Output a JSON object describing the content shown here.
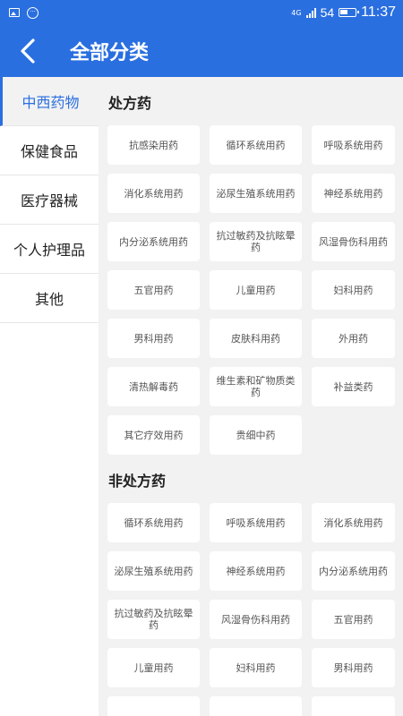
{
  "status_bar": {
    "network": "4G",
    "battery": "54",
    "time": "11:37"
  },
  "header": {
    "title": "全部分类"
  },
  "sidebar": {
    "items": [
      {
        "label": "中西药物",
        "active": true
      },
      {
        "label": "保健食品",
        "active": false
      },
      {
        "label": "医疗器械",
        "active": false
      },
      {
        "label": "个人护理品",
        "active": false
      },
      {
        "label": "其他",
        "active": false
      }
    ]
  },
  "sections": [
    {
      "title": "处方药",
      "items": [
        "抗感染用药",
        "循环系统用药",
        "呼吸系统用药",
        "消化系统用药",
        "泌尿生殖系统用药",
        "神经系统用药",
        "内分泌系统用药",
        "抗过敏药及抗眩晕药",
        "风湿骨伤科用药",
        "五官用药",
        "儿童用药",
        "妇科用药",
        "男科用药",
        "皮肤科用药",
        "外用药",
        "清热解毒药",
        "维生素和矿物质类药",
        "补益类药",
        "其它疗效用药",
        "贵细中药"
      ]
    },
    {
      "title": "非处方药",
      "items": [
        "循环系统用药",
        "呼吸系统用药",
        "消化系统用药",
        "泌尿生殖系统用药",
        "神经系统用药",
        "内分泌系统用药",
        "抗过敏药及抗眩晕药",
        "风湿骨伤科用药",
        "五官用药",
        "儿童用药",
        "妇科用药",
        "男科用药",
        "",
        "",
        ""
      ]
    }
  ]
}
